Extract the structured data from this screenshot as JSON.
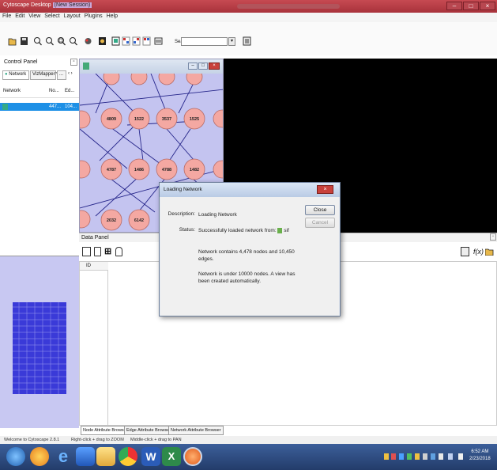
{
  "titlebar": {
    "app": "Cytoscape Desktop",
    "session": "(New Session)"
  },
  "menu": [
    "File",
    "Edit",
    "View",
    "Select",
    "Layout",
    "Plugins",
    "Help"
  ],
  "toolbar": {
    "search_label": "Search:",
    "search_value": ""
  },
  "control_panel": {
    "title": "Control Panel",
    "tabs": [
      "Network",
      "VizMapper™",
      "..."
    ],
    "columns": [
      "Network",
      "No...",
      "Ed..."
    ],
    "rows": [
      {
        "name": "",
        "counts": "447...",
        "edges": "104..."
      }
    ]
  },
  "network_view": {
    "nodes": [
      "4809",
      "1522",
      "3537",
      "1525",
      "4787",
      "1486",
      "4788",
      "1482",
      "2032",
      "6142"
    ]
  },
  "data_panel": {
    "title": "Data Panel",
    "column_header": "ID",
    "tabs": [
      "Node Attribute Browser",
      "Edge Attribute Browser",
      "Network Attribute Browser"
    ]
  },
  "dialog": {
    "title": "Loading Network",
    "description_label": "Description:",
    "description_value": "Loading Network",
    "status_label": "Status:",
    "status_line1": "Successfully loaded network from:",
    "status_file": "sif",
    "info1_line1": "Network contains 4,478 nodes and 10,450",
    "info1_line2": "edges.",
    "info2_line1": "Network is under 10000 nodes.  A view has",
    "info2_line2": "been created automatically.",
    "close_label": "Close",
    "cancel_label": "Cancel"
  },
  "statusbar": {
    "welcome": "Welcome to Cytoscape 2.8.1",
    "hint_zoom": "Right-click + drag to ZOOM",
    "hint_pan": "Middle-click + drag to PAN"
  },
  "taskbar": {
    "time": "6:52 AM",
    "date": "2/23/2018"
  },
  "colors": {
    "accent": "#1e90e6",
    "node_fill": "#f4a8a2",
    "network_bg": "#c4c4f0",
    "titlebar": "#b83a44"
  }
}
